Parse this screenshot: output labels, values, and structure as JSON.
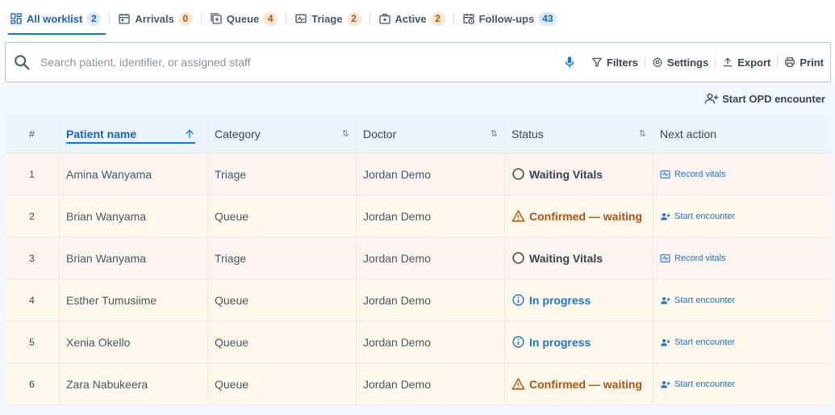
{
  "tabs": [
    {
      "label": "All worklist",
      "count": "2",
      "icon": "dashboard-icon",
      "badge_color": "blue",
      "active": true
    },
    {
      "label": "Arrivals",
      "count": "0",
      "icon": "calendar-icon",
      "badge_color": "orange",
      "active": false
    },
    {
      "label": "Queue",
      "count": "4",
      "icon": "queue-icon",
      "badge_color": "orange",
      "active": false
    },
    {
      "label": "Triage",
      "count": "2",
      "icon": "pulse-icon",
      "badge_color": "orange",
      "active": false
    },
    {
      "label": "Active",
      "count": "2",
      "icon": "medical-bag-icon",
      "badge_color": "orange",
      "active": false
    },
    {
      "label": "Follow-ups",
      "count": "43",
      "icon": "calendar-clock-icon",
      "badge_color": "blue",
      "active": false
    }
  ],
  "search": {
    "placeholder": "Search patient, identifier, or assigned staff",
    "value": ""
  },
  "toolbar": {
    "filters": "Filters",
    "settings": "Settings",
    "export": "Export",
    "print": "Print"
  },
  "start_opd": "Start OPD encounter",
  "table": {
    "headers": {
      "num": "#",
      "patient": "Patient name",
      "category": "Category",
      "doctor": "Doctor",
      "status": "Status",
      "next_action": "Next action"
    },
    "rows": [
      {
        "num": "1",
        "patient": "Amina Wanyama",
        "category": "Triage",
        "doctor": "Jordan Demo",
        "status": "Waiting Vitals",
        "status_kind": "waiting",
        "action": "Record vitals",
        "action_kind": "vitals",
        "tint": "rose"
      },
      {
        "num": "2",
        "patient": "Brian Wanyama",
        "category": "Queue",
        "doctor": "Jordan Demo",
        "status": "Confirmed — waiting",
        "status_kind": "confirmed",
        "action": "Start encounter",
        "action_kind": "encounter",
        "tint": "cream"
      },
      {
        "num": "3",
        "patient": "Brian Wanyama",
        "category": "Triage",
        "doctor": "Jordan Demo",
        "status": "Waiting Vitals",
        "status_kind": "waiting",
        "action": "Record vitals",
        "action_kind": "vitals",
        "tint": "rose"
      },
      {
        "num": "4",
        "patient": "Esther Tumusiime",
        "category": "Queue",
        "doctor": "Jordan Demo",
        "status": "In progress",
        "status_kind": "progress",
        "action": "Start encounter",
        "action_kind": "encounter",
        "tint": "cream"
      },
      {
        "num": "5",
        "patient": "Xenia Okello",
        "category": "Queue",
        "doctor": "Jordan Demo",
        "status": "In progress",
        "status_kind": "progress",
        "action": "Start encounter",
        "action_kind": "encounter",
        "tint": "cream"
      },
      {
        "num": "6",
        "patient": "Zara Nabukeera",
        "category": "Queue",
        "doctor": "Jordan Demo",
        "status": "Confirmed — waiting",
        "status_kind": "confirmed",
        "action": "Start encounter",
        "action_kind": "encounter",
        "tint": "cream"
      }
    ]
  },
  "colors": {
    "accent": "#1976d2",
    "warning": "#b45309",
    "row_rose": "#fdf3f1",
    "row_cream": "#fef7ec"
  }
}
